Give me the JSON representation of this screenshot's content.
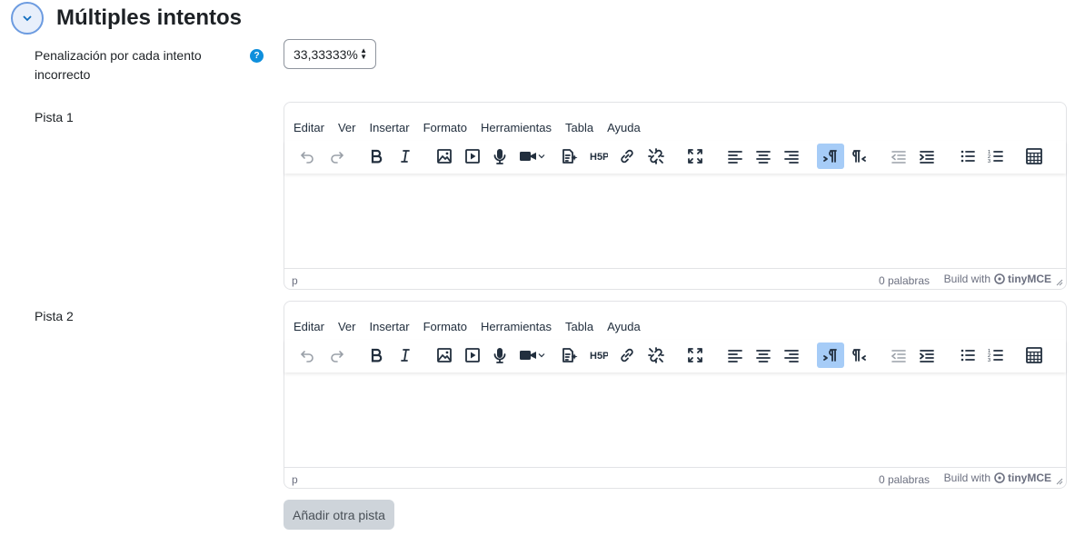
{
  "section": {
    "title": "Múltiples intentos"
  },
  "penalty": {
    "label_line1": "Penalización por cada intento",
    "label_line2": "incorrecto",
    "help": "?",
    "value": "33,33333%"
  },
  "editors": [
    {
      "label": "Pista 1",
      "path": "p",
      "words": "0 palabras",
      "build": "Build with",
      "brand": "tinyMCE"
    },
    {
      "label": "Pista 2",
      "path": "p",
      "words": "0 palabras",
      "build": "Build with",
      "brand": "tinyMCE"
    }
  ],
  "menu": [
    "Editar",
    "Ver",
    "Insertar",
    "Formato",
    "Herramientas",
    "Tabla",
    "Ayuda"
  ],
  "toolbar_icons": [
    "undo-icon",
    "redo-icon",
    "bold-icon",
    "italic-icon",
    "image-icon",
    "media-icon",
    "microphone-icon",
    "video-camera-icon",
    "ai-generate-icon",
    "h5p-icon",
    "link-icon",
    "unlink-icon",
    "fullscreen-icon",
    "align-left-icon",
    "align-center-icon",
    "align-right-icon",
    "ltr-icon",
    "rtl-icon",
    "outdent-icon",
    "indent-icon",
    "bullet-list-icon",
    "numbered-list-icon",
    "calculator-icon"
  ],
  "add_hint_button": "Añadir otra pista",
  "colors": {
    "accent": "#0f6cbf",
    "active": "#a6ccf7",
    "button": "#ced4da"
  }
}
